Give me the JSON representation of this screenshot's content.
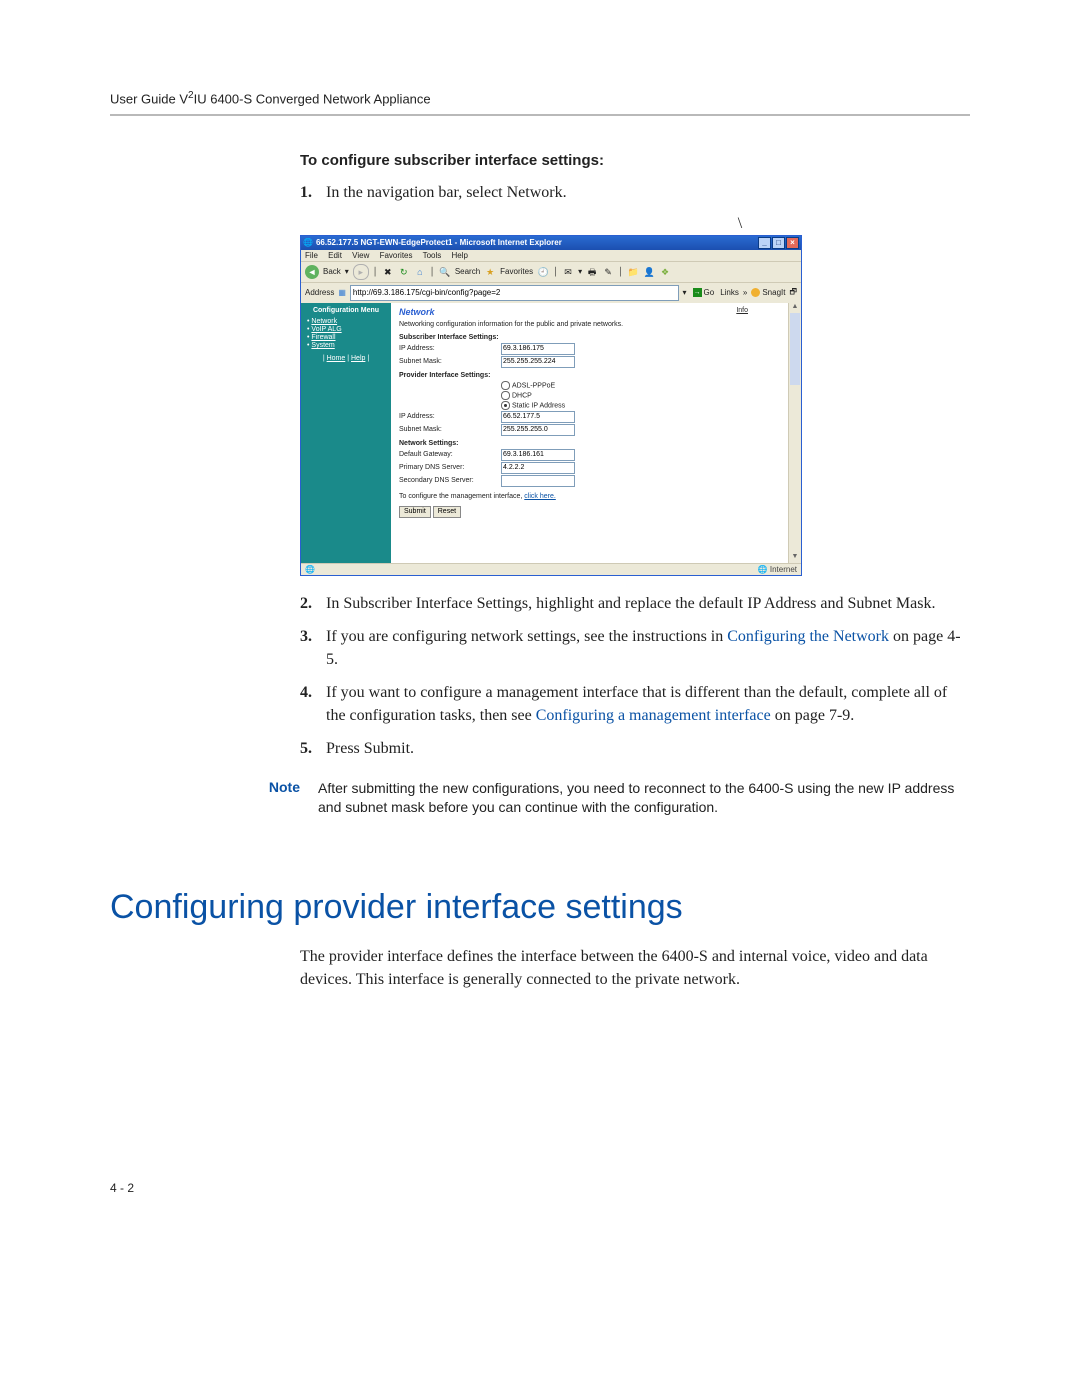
{
  "header": "User Guide V²IU 6400-S Converged Network Appliance",
  "subhead": "To configure subscriber interface settings:",
  "backslash_mark": "\\",
  "steps": [
    {
      "num": "1.",
      "body": "In the navigation bar, select Network."
    },
    {
      "num": "2.",
      "body": "In Subscriber Interface Settings, highlight and replace the default IP Address and Subnet Mask."
    },
    {
      "num": "3.",
      "pre": "If you are configuring network settings, see the instructions in ",
      "link": "Configuring the Network",
      "post": " on page 4-5."
    },
    {
      "num": "4.",
      "pre": "If you want to configure a management interface that is different than the default, complete all of the configuration tasks, then see ",
      "link": "Configuring a management interface",
      "post": " on page 7-9."
    },
    {
      "num": "5.",
      "body": "Press Submit."
    }
  ],
  "note": {
    "label": "Note",
    "body": "After submitting the new configurations, you need to reconnect to the 6400-S using the new IP address and subnet mask before you can continue with the configuration."
  },
  "section_heading": "Configuring provider interface settings",
  "section_para": "The provider interface defines the interface between the 6400-S and internal voice, video and data devices.  This interface is generally connected to the private network.",
  "page_number": "4 - 2",
  "screenshot": {
    "window_title": "66.52.177.5 NGT-EWN-EdgeProtect1 - Microsoft Internet Explorer",
    "menus": [
      "File",
      "Edit",
      "View",
      "Favorites",
      "Tools",
      "Help"
    ],
    "toolbar": {
      "back": "Back",
      "search": "Search",
      "favorites": "Favorites"
    },
    "address_label": "Address",
    "address_value": "http://69.3.186.175/cgi-bin/config?page=2",
    "go_label": "Go",
    "links_label": "Links",
    "snagit_label": "SnagIt",
    "sidebar": {
      "title": "Configuration Menu",
      "items": [
        "Network",
        "VoIP ALG",
        "Firewall",
        "System"
      ],
      "bottom": [
        "Home",
        "Help"
      ]
    },
    "panel": {
      "info": "Info",
      "heading": "Network",
      "desc": "Networking configuration information for the public and private networks.",
      "sub_group": "Subscriber Interface Settings:",
      "sub_ip_label": "IP Address:",
      "sub_ip_value": "69.3.186.175",
      "sub_mask_label": "Subnet Mask:",
      "sub_mask_value": "255.255.255.224",
      "prov_group": "Provider Interface Settings:",
      "radio_adsl": "ADSL-PPPoE",
      "radio_dhcp": "DHCP",
      "radio_static": "Static IP Address",
      "prov_ip_label": "IP Address:",
      "prov_ip_value": "66.52.177.5",
      "prov_mask_label": "Subnet Mask:",
      "prov_mask_value": "255.255.255.0",
      "net_group": "Network Settings:",
      "gw_label": "Default Gateway:",
      "gw_value": "69.3.186.161",
      "dns1_label": "Primary DNS Server:",
      "dns1_value": "4.2.2.2",
      "dns2_label": "Secondary DNS Server:",
      "dns2_value": "",
      "mgmt_pre": "To configure the management interface, ",
      "mgmt_link": "click here.",
      "submit": "Submit",
      "reset": "Reset"
    },
    "statusbar_right": "Internet"
  }
}
